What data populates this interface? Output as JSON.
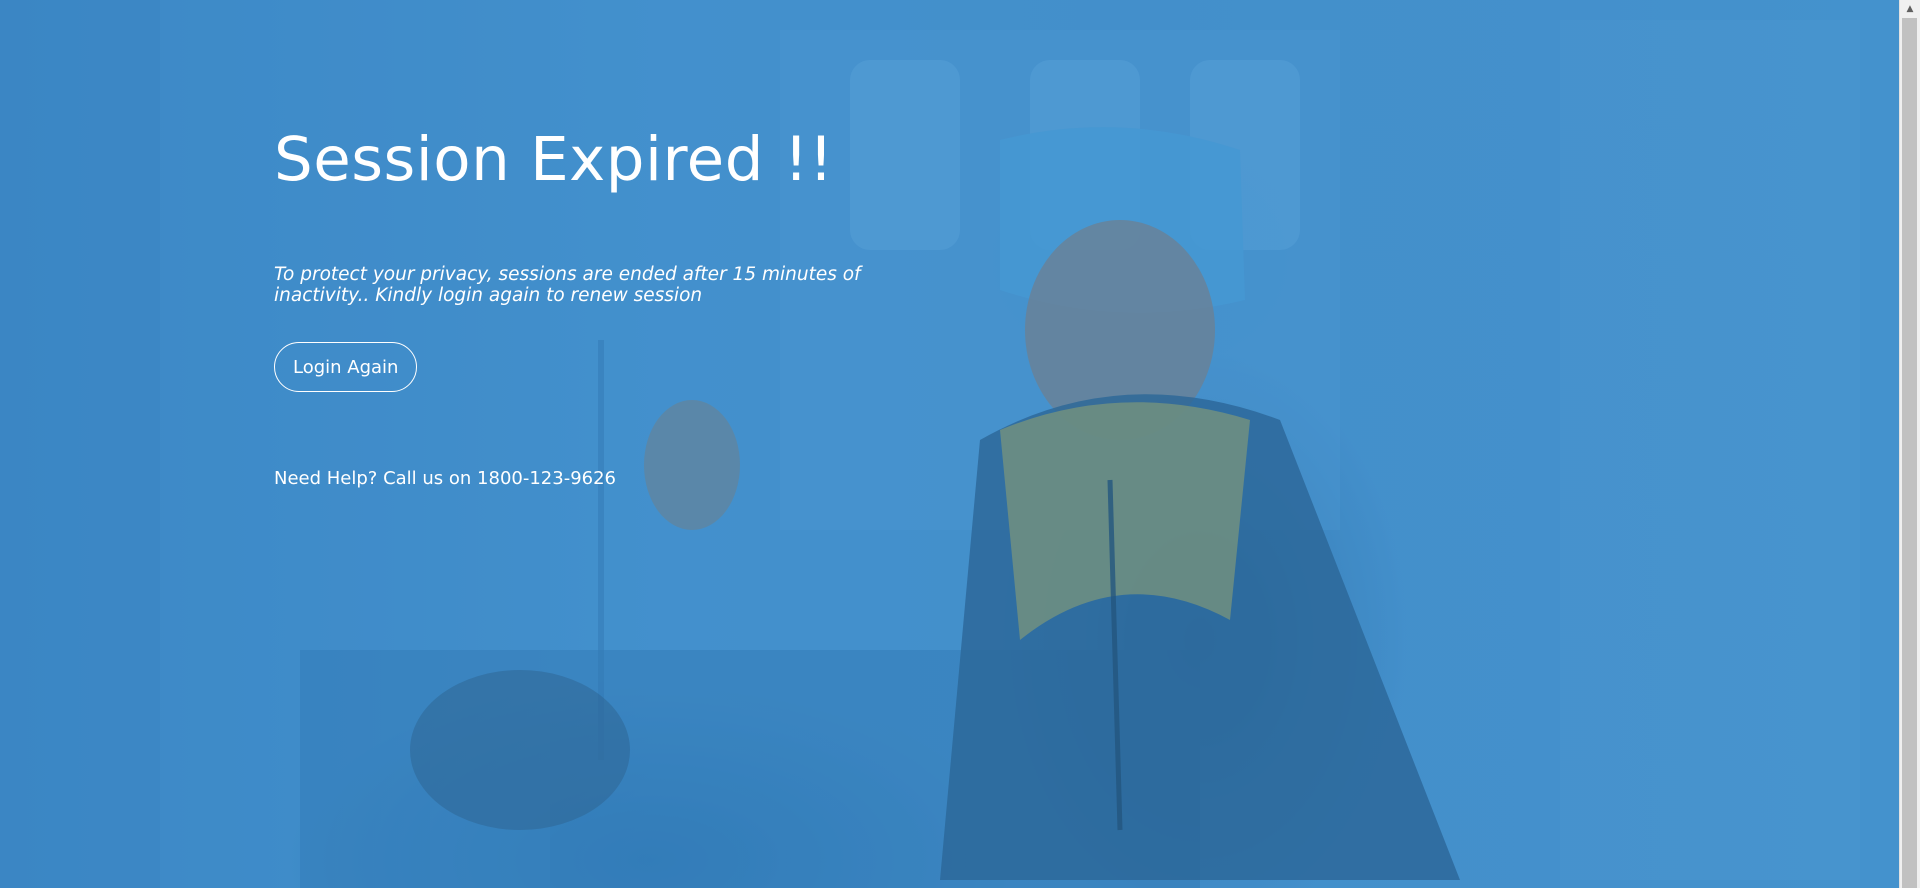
{
  "page": {
    "title": "Session Expired !!",
    "description": "To protect your privacy, sessions are ended after 15 minutes of inactivity.. Kindly login again to renew session",
    "login_button_label": "Login Again",
    "help_text": "Need Help? Call us on 1800-123-9626"
  },
  "colors": {
    "background_tint": "#4a90c8",
    "text": "#ffffff"
  },
  "icons": {
    "scroll_up": "chevron-up-icon"
  }
}
